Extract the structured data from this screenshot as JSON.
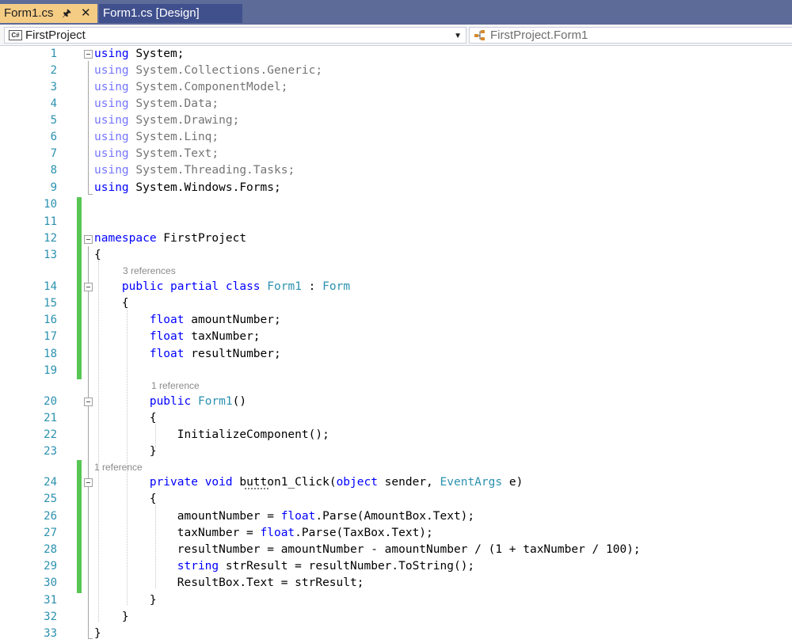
{
  "tabs": [
    {
      "label": "Form1.cs",
      "active": true
    },
    {
      "label": "Form1.cs [Design]",
      "active": false
    }
  ],
  "navbar": {
    "project": "FirstProject",
    "type": "FirstProject.Form1",
    "lang_badge": "C#"
  },
  "lenses": {
    "class_refs": "3 references",
    "ctor_refs": "1 reference",
    "handler_refs": "1 reference"
  },
  "colors": {
    "tab_active": "#f5cc84",
    "tab_inactive": "#40508d",
    "keyword": "#0000ff",
    "type": "#2b91af",
    "line_number": "#2b91af",
    "changed_line_marker": "#57c654"
  },
  "lines": [
    {
      "n": "1",
      "code": "using System;"
    },
    {
      "n": "2",
      "code": "using System.Collections.Generic;"
    },
    {
      "n": "3",
      "code": "using System.ComponentModel;"
    },
    {
      "n": "4",
      "code": "using System.Data;"
    },
    {
      "n": "5",
      "code": "using System.Drawing;"
    },
    {
      "n": "6",
      "code": "using System.Linq;"
    },
    {
      "n": "7",
      "code": "using System.Text;"
    },
    {
      "n": "8",
      "code": "using System.Threading.Tasks;"
    },
    {
      "n": "9",
      "code": "using System.Windows.Forms;"
    },
    {
      "n": "10",
      "code": ""
    },
    {
      "n": "11",
      "code": ""
    },
    {
      "n": "12",
      "code": "namespace FirstProject"
    },
    {
      "n": "13",
      "code": "{"
    },
    {
      "n": "14",
      "code": "    public partial class Form1 : Form"
    },
    {
      "n": "15",
      "code": "    {"
    },
    {
      "n": "16",
      "code": "        float amountNumber;"
    },
    {
      "n": "17",
      "code": "        float taxNumber;"
    },
    {
      "n": "18",
      "code": "        float resultNumber;"
    },
    {
      "n": "19",
      "code": ""
    },
    {
      "n": "20",
      "code": "        public Form1()"
    },
    {
      "n": "21",
      "code": "        {"
    },
    {
      "n": "22",
      "code": "            InitializeComponent();"
    },
    {
      "n": "23",
      "code": "        }"
    },
    {
      "n": "24",
      "code": "        private void button1_Click(object sender, EventArgs e)"
    },
    {
      "n": "25",
      "code": "        {"
    },
    {
      "n": "26",
      "code": "            amountNumber = float.Parse(AmountBox.Text);"
    },
    {
      "n": "27",
      "code": "            taxNumber = float.Parse(TaxBox.Text);"
    },
    {
      "n": "28",
      "code": "            resultNumber = amountNumber - amountNumber / (1 + taxNumber / 100);"
    },
    {
      "n": "29",
      "code": "            string strResult = resultNumber.ToString();"
    },
    {
      "n": "30",
      "code": "            ResultBox.Text = strResult;"
    },
    {
      "n": "31",
      "code": "        }"
    },
    {
      "n": "32",
      "code": "    }"
    },
    {
      "n": "33",
      "code": "}"
    }
  ]
}
